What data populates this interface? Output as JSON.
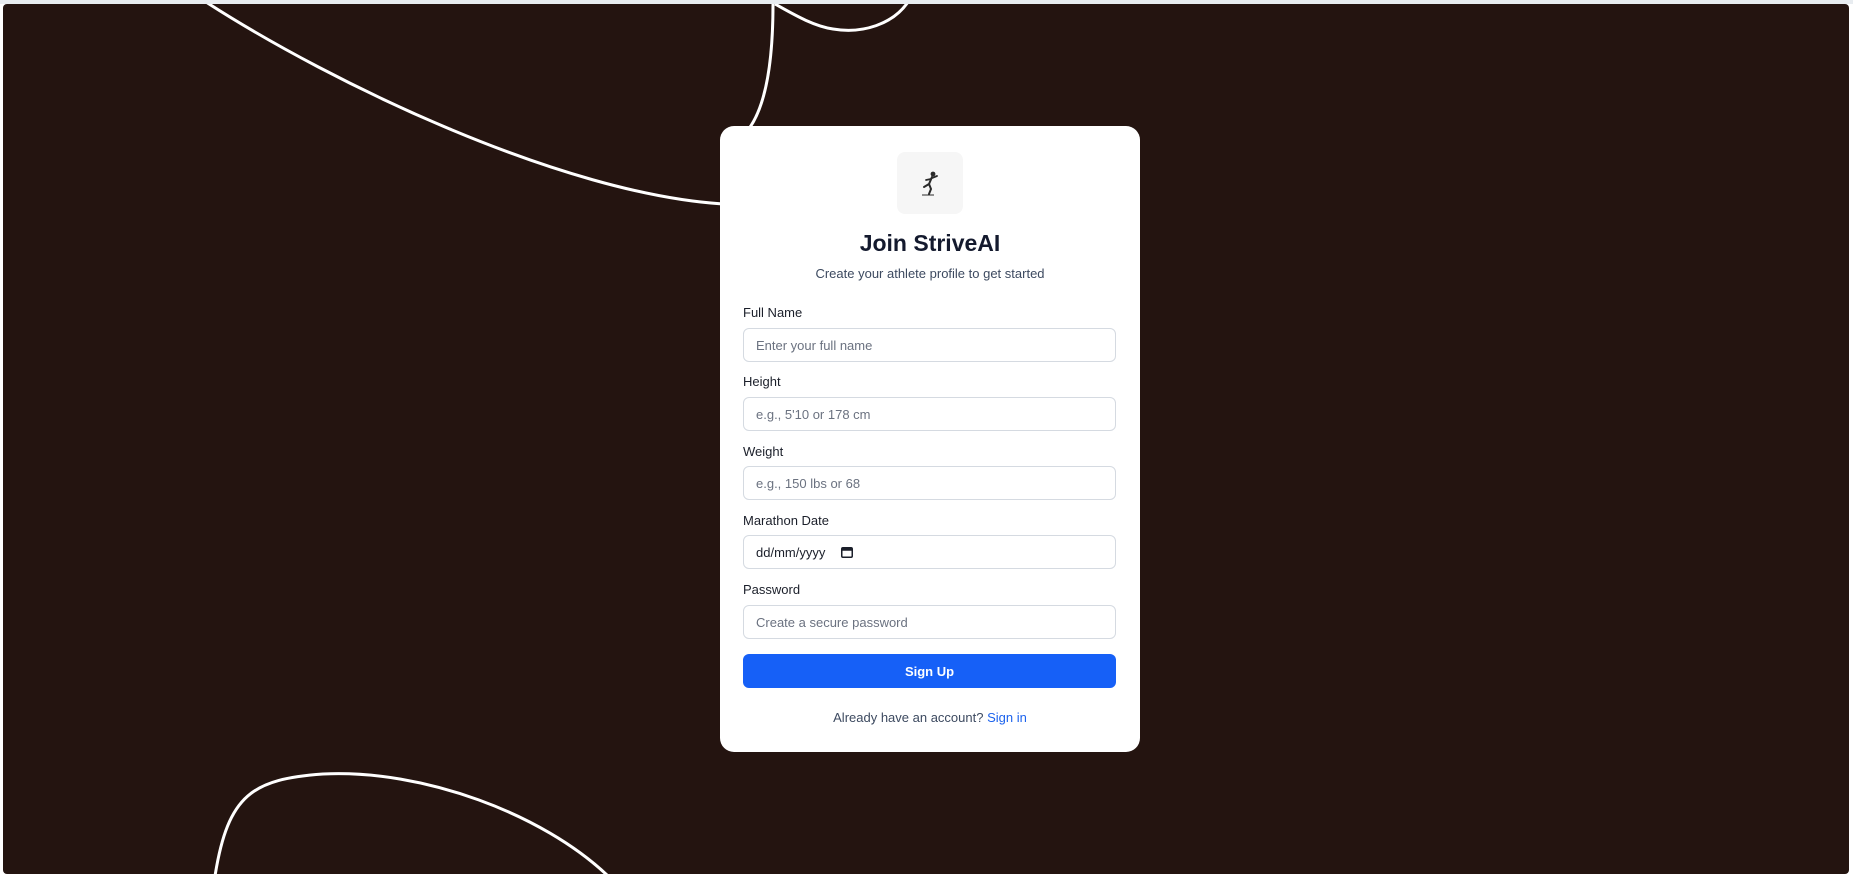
{
  "app": {
    "title": "Join StriveAI",
    "subtitle": "Create your athlete profile to get started",
    "logo_icon": "runner-icon"
  },
  "form": {
    "full_name": {
      "label": "Full Name",
      "placeholder": "Enter your full name",
      "value": ""
    },
    "height": {
      "label": "Height",
      "placeholder": "e.g., 5'10 or 178 cm",
      "value": ""
    },
    "weight": {
      "label": "Weight",
      "placeholder": "e.g., 150 lbs or 68",
      "value": ""
    },
    "marathon_date": {
      "label": "Marathon Date",
      "placeholder": "dd/mm/yyyy",
      "icon": "calendar-icon"
    },
    "password": {
      "label": "Password",
      "placeholder": "Create a secure password",
      "value": ""
    },
    "submit_label": "Sign Up"
  },
  "footer": {
    "prompt": "Already have an account?",
    "link_label": "Sign in"
  },
  "colors": {
    "background": "#241410",
    "accent": "#1660f7",
    "link": "#1d63ed"
  }
}
